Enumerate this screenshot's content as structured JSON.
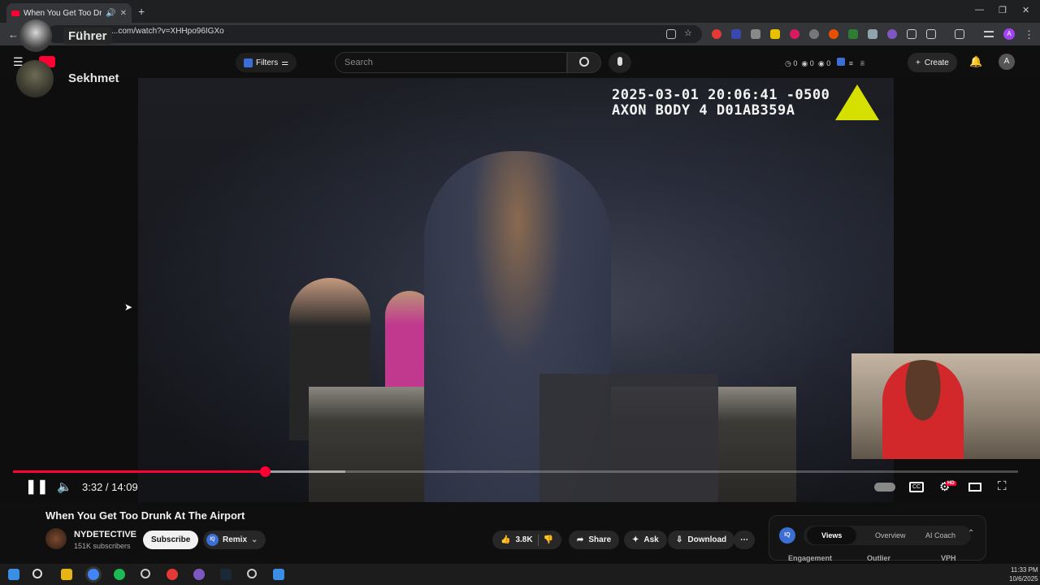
{
  "browser": {
    "tab_title": "When You Get Too Drunk At...",
    "url": "...com/watch?v=XHHpo96IGXo"
  },
  "overlay": {
    "user1_name": "Führer",
    "user2_name": "Sekhmet"
  },
  "header": {
    "filters_label": "Filters",
    "search_placeholder": "Search",
    "stats": [
      "0",
      "0",
      "0"
    ],
    "create_label": "Create",
    "avatar_letter": "A"
  },
  "video": {
    "timestamp_line1": "2025-03-01 20:06:41 -0500",
    "timestamp_line2": "AXON BODY 4 D01AB359A",
    "current_time": "3:32",
    "duration": "14:09",
    "time_display": "3:32 / 14:09",
    "progress_fraction": 0.251,
    "buffered_fraction": 0.331,
    "quality_badge": "HD"
  },
  "meta": {
    "title": "When You Get Too Drunk At The Airport",
    "channel_name": "NYDETECTIVE",
    "subscribers": "151K subscribers",
    "subscribe_label": "Subscribe",
    "remix_label": "Remix",
    "like_count": "3.8K",
    "share_label": "Share",
    "ask_label": "Ask",
    "download_label": "Download"
  },
  "analytics_panel": {
    "badge": "IQ",
    "tabs": [
      "Views",
      "Overview",
      "AI Coach"
    ],
    "active_tab": "Views",
    "columns": [
      "Engagement",
      "Outlier",
      "VPH"
    ]
  },
  "system": {
    "time": "11:33 PM",
    "date": "10/6/2025"
  },
  "colors": {
    "accent": "#ff0033",
    "background": "#0f0f0f",
    "iq_blue": "#3b6fd6"
  }
}
